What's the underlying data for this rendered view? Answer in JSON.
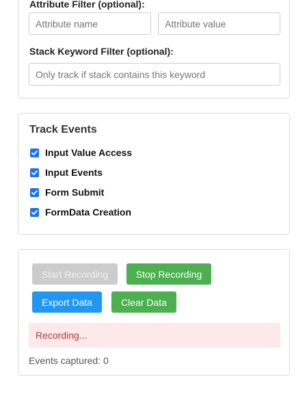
{
  "filters": {
    "attribute_label": "Attribute Filter (optional):",
    "attribute_name_placeholder": "Attribute name",
    "attribute_value_placeholder": "Attribute value",
    "stack_label": "Stack Keyword Filter (optional):",
    "stack_placeholder": "Only track if stack contains this keyword"
  },
  "events": {
    "title": "Track Events",
    "items": [
      {
        "label": "Input Value Access",
        "checked": true
      },
      {
        "label": "Input Events",
        "checked": true
      },
      {
        "label": "Form Submit",
        "checked": true
      },
      {
        "label": "FormData Creation",
        "checked": true
      }
    ]
  },
  "controls": {
    "start_label": "Start Recording",
    "stop_label": "Stop Recording",
    "export_label": "Export Data",
    "clear_label": "Clear Data",
    "status": "Recording...",
    "events_count": "Events captured: 0"
  },
  "colors": {
    "accent_green": "#4caf50",
    "accent_blue": "#2196f3",
    "disabled_gray": "#cccccc",
    "status_bg": "#fde8ea",
    "status_text": "#b23b3b",
    "checkbox_blue": "#1a73e8"
  }
}
